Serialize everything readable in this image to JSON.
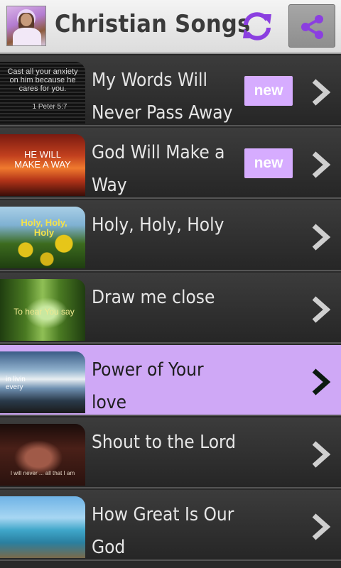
{
  "app": {
    "title": "Christian Songs",
    "accent_color": "#8b3fe0",
    "selected_row_color": "#cfa8f6",
    "badge_color": "#d6acff"
  },
  "toolbar": {
    "refresh_icon": "refresh-icon",
    "share_icon": "share-icon"
  },
  "songs": [
    {
      "title": "My Words Will Never Pass Away",
      "badge": "new",
      "thumb_caption": "Cast all your anxiety on him because he cares for you.",
      "thumb_ref": "1 Peter 5:7"
    },
    {
      "title": "God Will Make a Way",
      "badge": "new",
      "thumb_caption": "HE WILL MAKE A WAY"
    },
    {
      "title": "Holy, Holy, Holy",
      "thumb_caption": "Holy, Holy, Holy"
    },
    {
      "title": "Draw me close",
      "thumb_caption": "To hear You say"
    },
    {
      "title": "Power of Your love",
      "selected": true,
      "thumb_caption": "in livin every"
    },
    {
      "title": "Shout to the Lord",
      "thumb_caption": "I will never ... all that I am"
    },
    {
      "title": "How Great Is Our God"
    }
  ]
}
